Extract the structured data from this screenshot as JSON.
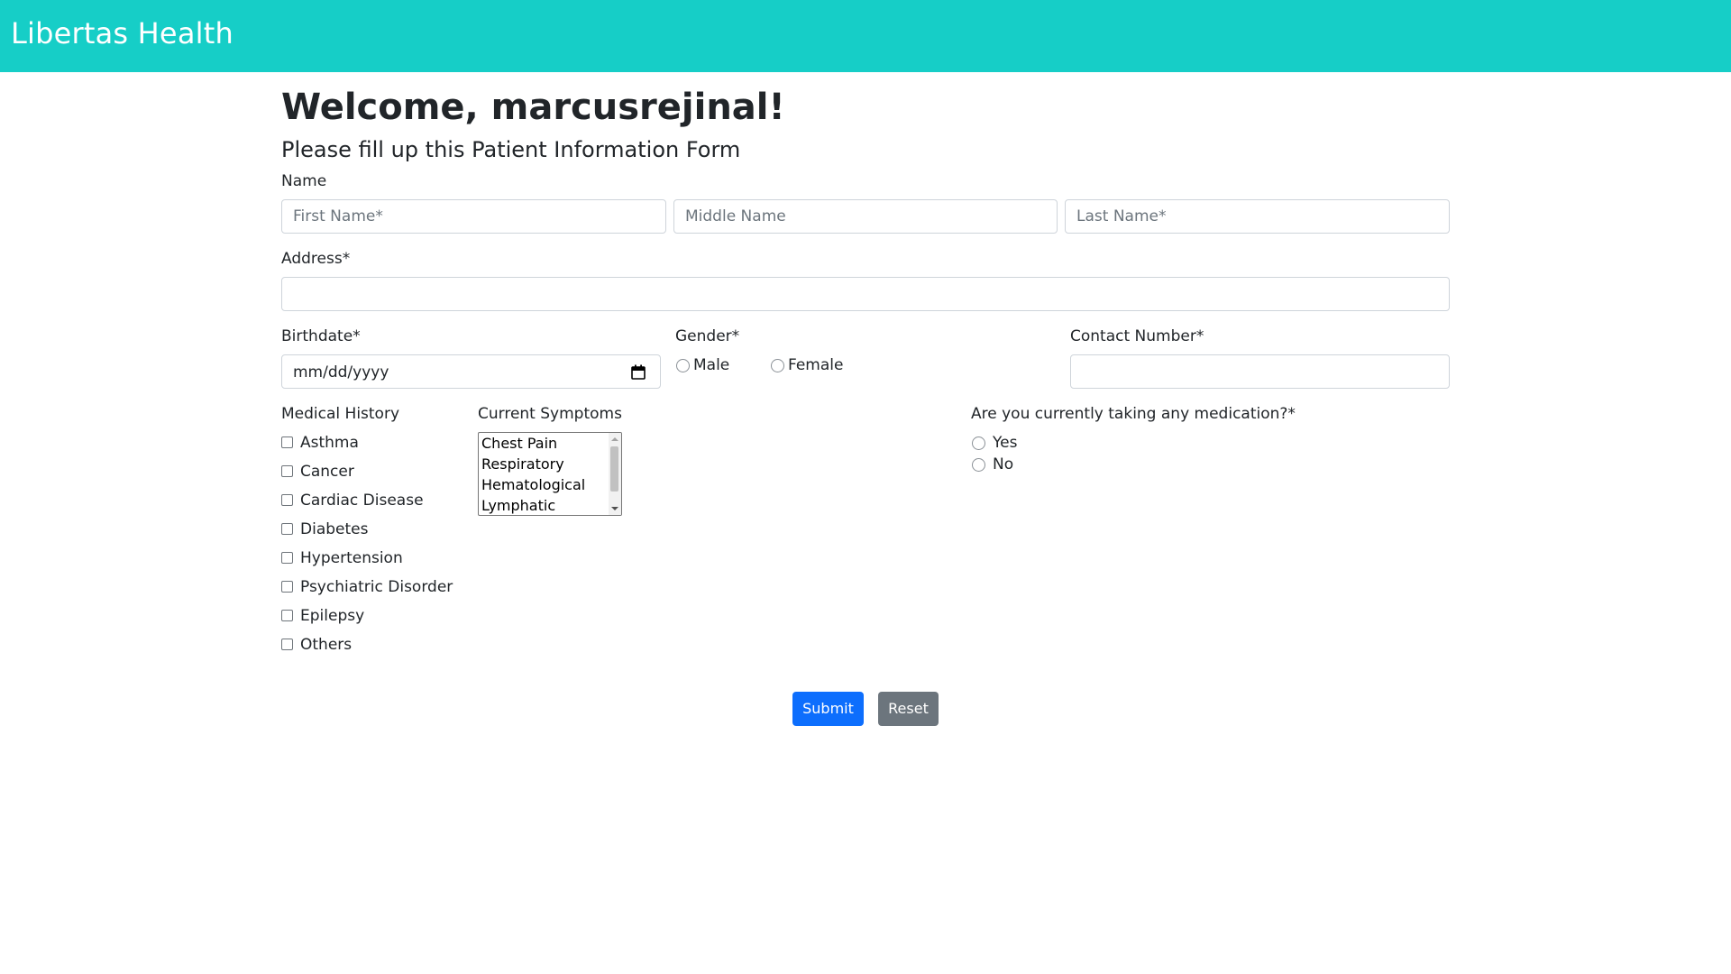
{
  "app": {
    "brand": "Libertas Health"
  },
  "header": {
    "welcome": "Welcome, marcusrejinal!",
    "subtitle": "Please fill up this Patient Information Form"
  },
  "name": {
    "label": "Name",
    "first_placeholder": "First Name*",
    "middle_placeholder": "Middle Name",
    "last_placeholder": "Last Name*"
  },
  "address": {
    "label": "Address*",
    "value": ""
  },
  "birthdate": {
    "label": "Birthdate*",
    "value": "mm/dd/yyyy"
  },
  "gender": {
    "label": "Gender*",
    "options": [
      "Male",
      "Female"
    ]
  },
  "contact": {
    "label": "Contact Number*",
    "value": ""
  },
  "medical_history": {
    "label": "Medical History",
    "options": [
      "Asthma",
      "Cancer",
      "Cardiac Disease",
      "Diabetes",
      "Hypertension",
      "Psychiatric Disorder",
      "Epilepsy",
      "Others"
    ]
  },
  "symptoms": {
    "label": "Current Symptoms",
    "options": [
      "Chest Pain",
      "Respiratory",
      "Hematological",
      "Lymphatic"
    ]
  },
  "medication": {
    "label": "Are you currently taking any medication?*",
    "options": [
      "Yes",
      "No"
    ]
  },
  "actions": {
    "submit": "Submit",
    "reset": "Reset"
  },
  "colors": {
    "navbar": "#16cec7",
    "primary": "#0d6efd",
    "secondary": "#6c757d"
  },
  "icons": {
    "birthdate": "calendar-icon"
  }
}
